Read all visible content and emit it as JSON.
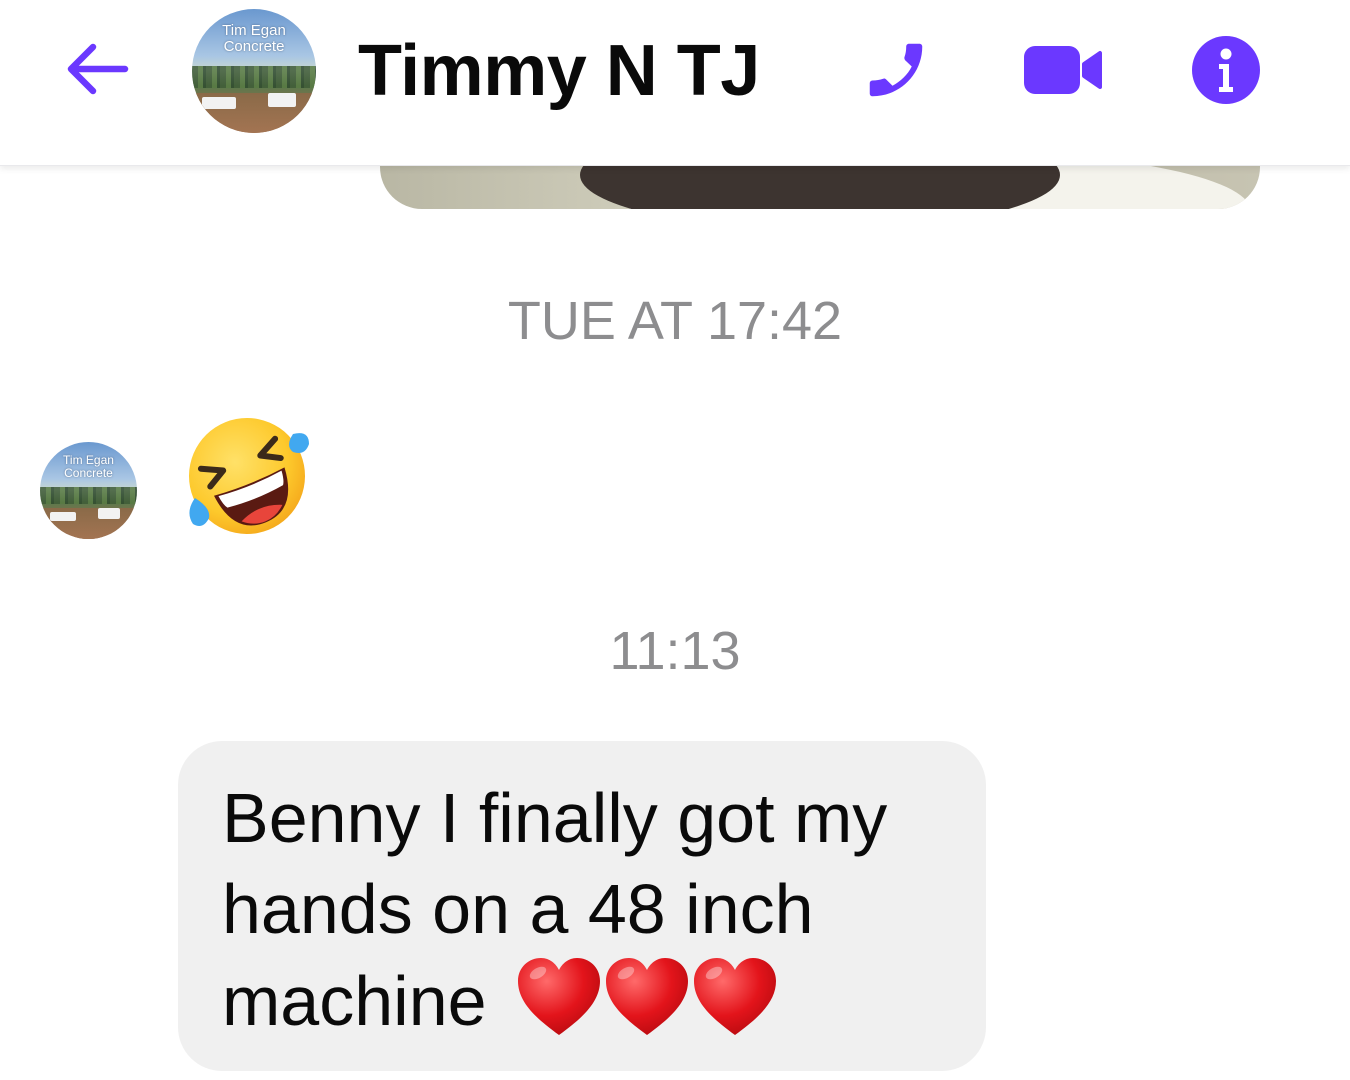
{
  "header": {
    "title": "Timmy N TJ",
    "avatar_text_line1": "Tim Egan",
    "avatar_text_line2": "Concrete",
    "accent_color": "#6b38ff",
    "icons": [
      "back-arrow-icon",
      "phone-icon",
      "video-camera-icon",
      "info-icon"
    ]
  },
  "thread": {
    "timestamp_1": "TUE AT 17:42",
    "timestamp_2": "11:13",
    "sender_avatar_text_line1": "Tim Egan",
    "sender_avatar_text_line2": "Concrete",
    "reaction_emoji": "rolling-on-the-floor-laughing",
    "message_text": "Benny I finally got my hands on a 48 inch machine",
    "message_trailing_emoji": "❤️❤️❤️"
  }
}
